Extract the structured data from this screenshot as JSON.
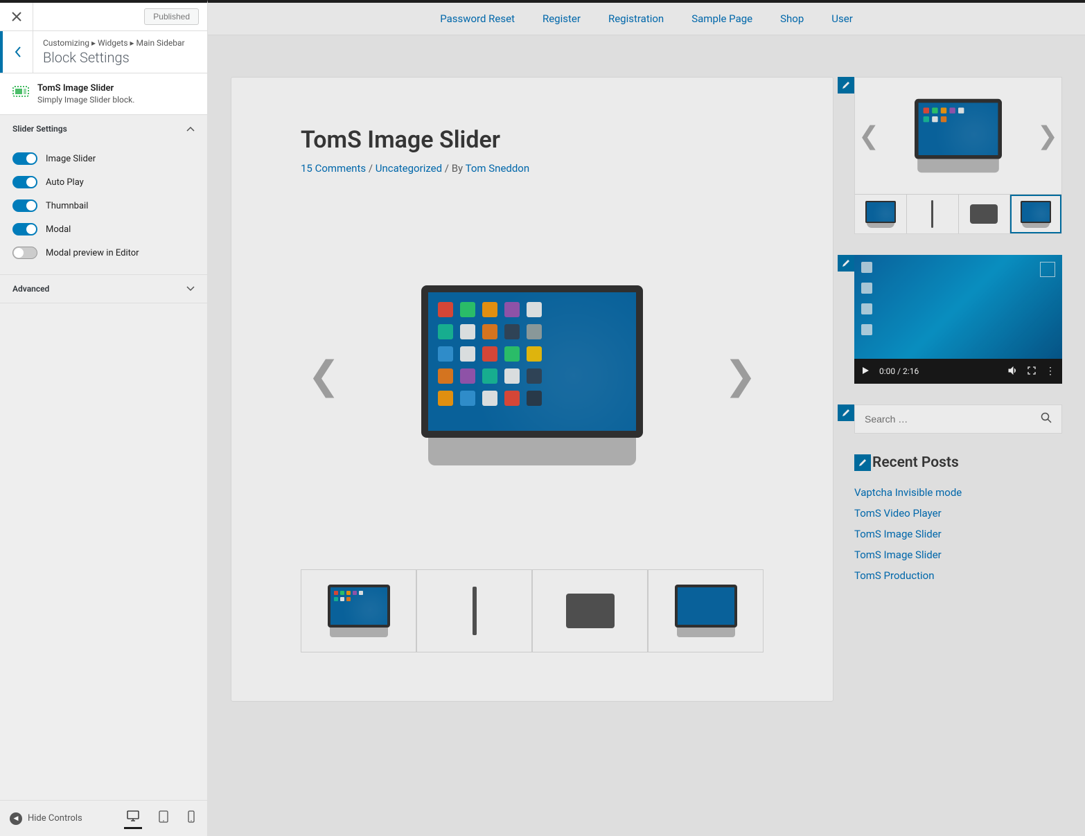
{
  "header": {
    "publish_label": "Published"
  },
  "breadcrumb": {
    "root": "Customizing",
    "sep": "▸",
    "part1": "Widgets",
    "part2": "Main Sidebar",
    "panel_title": "Block Settings"
  },
  "block": {
    "title": "TomS Image Slider",
    "desc": "Simply Image Slider block."
  },
  "section_slider": {
    "title": "Slider Settings",
    "toggles": [
      {
        "label": "Image Slider",
        "on": true
      },
      {
        "label": "Auto Play",
        "on": true
      },
      {
        "label": "Thumnbail",
        "on": true
      },
      {
        "label": "Modal",
        "on": true
      },
      {
        "label": "Modal preview in Editor",
        "on": false
      }
    ]
  },
  "section_advanced": {
    "title": "Advanced"
  },
  "footer": {
    "hide_controls": "Hide Controls"
  },
  "nav": {
    "items": [
      "Password Reset",
      "Register",
      "Registration",
      "Sample Page",
      "Shop",
      "User"
    ]
  },
  "post": {
    "title": "TomS Image Slider",
    "comments": "15 Comments",
    "sep1": " / ",
    "category": "Uncategorized",
    "sep2": " / By ",
    "author": "Tom Sneddon"
  },
  "video": {
    "time": "0:00 / 2:16"
  },
  "search": {
    "placeholder": "Search …"
  },
  "recent": {
    "title": "Recent Posts",
    "items": [
      "Vaptcha Invisible mode",
      "TomS Video Player",
      "TomS Image Slider",
      "TomS Image Slider",
      "TomS Production"
    ]
  },
  "colors": {
    "accent": "#0073aa",
    "link": "#0170b9"
  }
}
